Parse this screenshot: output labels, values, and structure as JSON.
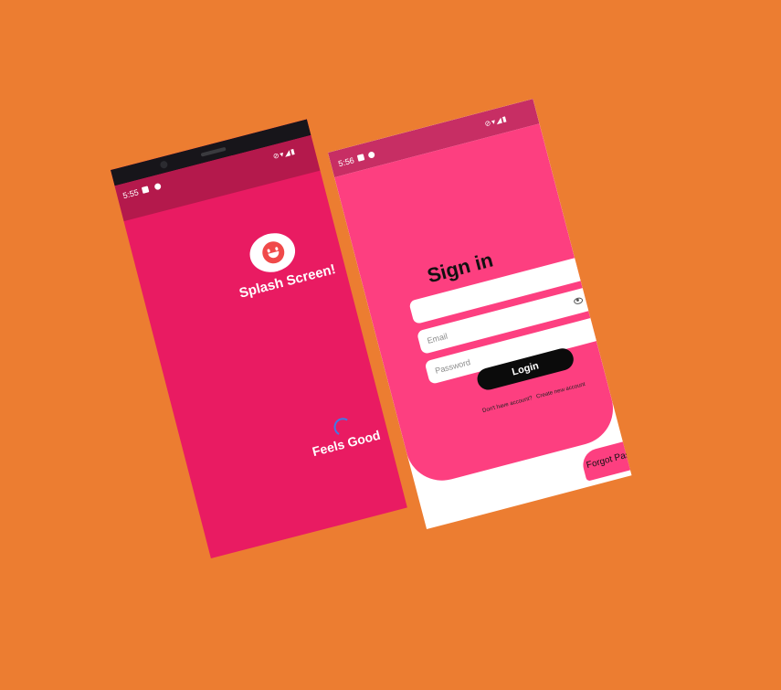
{
  "splash_phone": {
    "status_time": "5:55",
    "title": "Splash Screen!",
    "footer": "Feels Good",
    "colors": {
      "background": "#e91b62",
      "status_bar": "#b4194c",
      "spinner": "#3d7be8"
    }
  },
  "signin_phone": {
    "status_time": "5:56",
    "title": "Sign in",
    "email_placeholder": "Email",
    "password_placeholder": "Password",
    "login_label": "Login",
    "no_account_text": "Don't have account?",
    "create_account_link": "Create new account",
    "forgot_password_label": "Forgot Password",
    "colors": {
      "card": "#fd3f80",
      "status_bar": "#c72e64",
      "button": "#0b0b0b"
    }
  },
  "page": {
    "background_color": "#ec7d31"
  }
}
